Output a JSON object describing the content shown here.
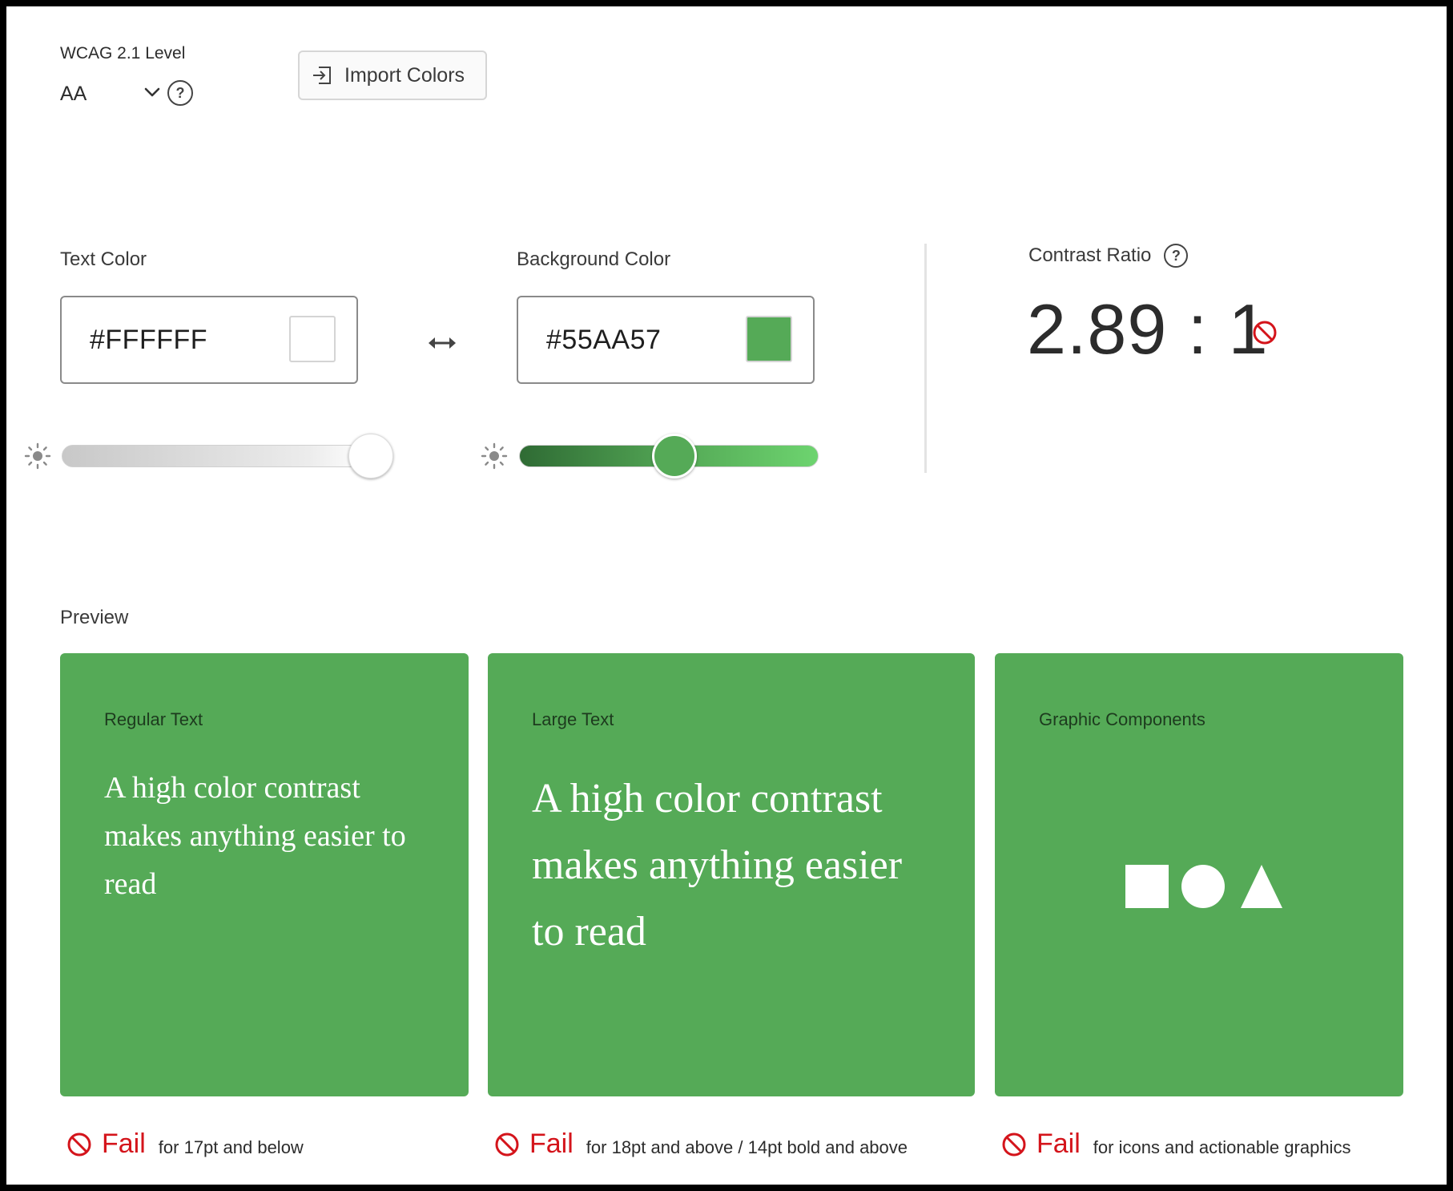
{
  "wcag": {
    "label": "WCAG 2.1 Level",
    "level": "AA",
    "help_glyph": "?"
  },
  "toolbar": {
    "import_label": "Import Colors"
  },
  "text_color": {
    "label": "Text Color",
    "hex": "#FFFFFF",
    "swatch": "#FFFFFF",
    "brightness": 1.0
  },
  "background_color": {
    "label": "Background Color",
    "hex": "#55AA57",
    "swatch": "#55AA57",
    "brightness": 0.52
  },
  "contrast": {
    "label": "Contrast Ratio",
    "value": "2.89 : 1",
    "help_glyph": "?",
    "status_icon": "prohibited-icon"
  },
  "preview": {
    "label": "Preview",
    "cards": [
      {
        "title": "Regular Text",
        "sample": "A high color contrast makes anything easier to read",
        "result": "Fail",
        "description": "for 17pt and below"
      },
      {
        "title": "Large Text",
        "sample": "A high color contrast makes anything easier to read",
        "result": "Fail",
        "description": "for 18pt and above / 14pt bold and above"
      },
      {
        "title": "Graphic Components",
        "shapes": [
          "square-icon",
          "circle-icon",
          "triangle-icon"
        ],
        "result": "Fail",
        "description": "for icons and actionable graphics"
      }
    ]
  },
  "colors": {
    "fail": "#D4141B",
    "card_background": "#55AA57",
    "sample_text": "#FFFFFF"
  }
}
